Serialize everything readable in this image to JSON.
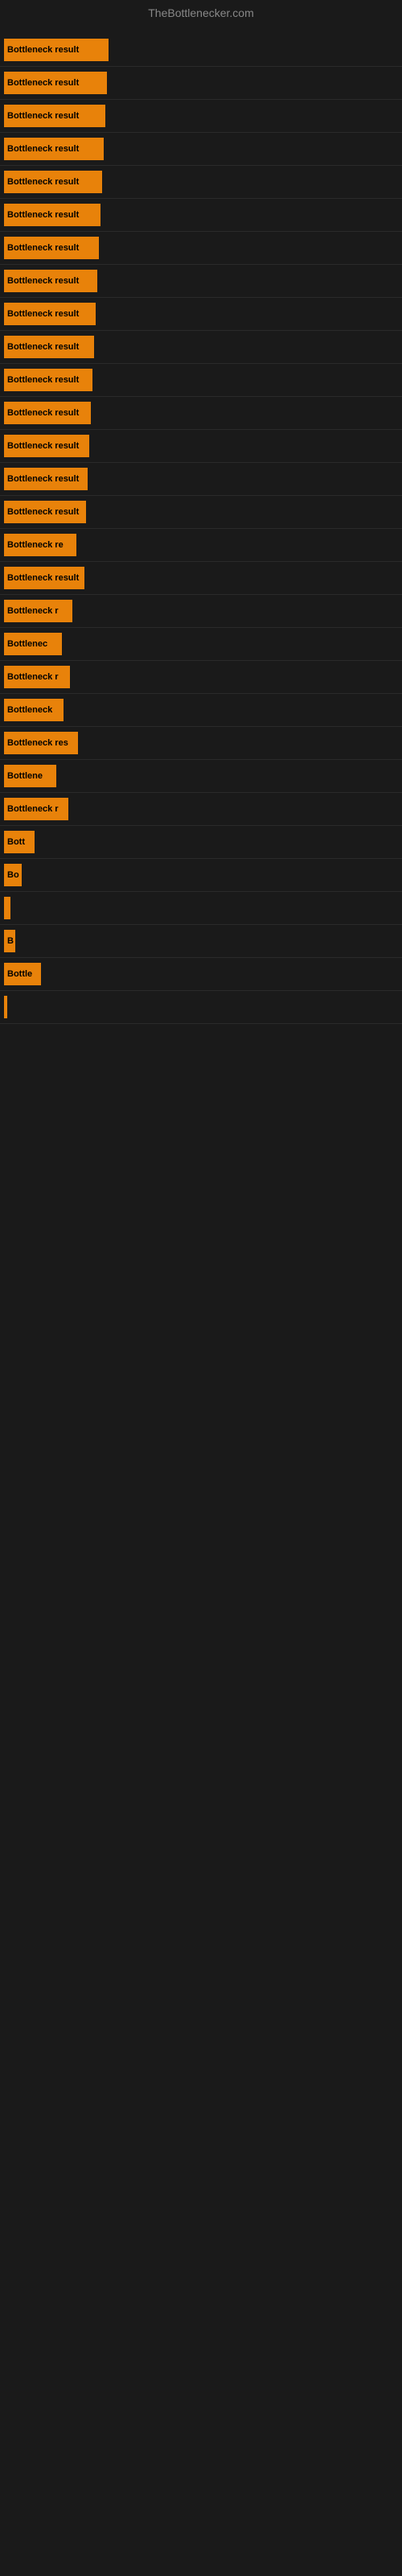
{
  "site": {
    "title": "TheBottlenecker.com"
  },
  "bars": [
    {
      "label": "Bottleneck result",
      "width": 130
    },
    {
      "label": "Bottleneck result",
      "width": 128
    },
    {
      "label": "Bottleneck result",
      "width": 126
    },
    {
      "label": "Bottleneck result",
      "width": 124
    },
    {
      "label": "Bottleneck result",
      "width": 122
    },
    {
      "label": "Bottleneck result",
      "width": 120
    },
    {
      "label": "Bottleneck result",
      "width": 118
    },
    {
      "label": "Bottleneck result",
      "width": 116
    },
    {
      "label": "Bottleneck result",
      "width": 114
    },
    {
      "label": "Bottleneck result",
      "width": 112
    },
    {
      "label": "Bottleneck result",
      "width": 110
    },
    {
      "label": "Bottleneck result",
      "width": 108
    },
    {
      "label": "Bottleneck result",
      "width": 106
    },
    {
      "label": "Bottleneck result",
      "width": 104
    },
    {
      "label": "Bottleneck result",
      "width": 102
    },
    {
      "label": "Bottleneck re",
      "width": 90
    },
    {
      "label": "Bottleneck result",
      "width": 100
    },
    {
      "label": "Bottleneck r",
      "width": 85
    },
    {
      "label": "Bottlenec",
      "width": 72
    },
    {
      "label": "Bottleneck r",
      "width": 82
    },
    {
      "label": "Bottleneck",
      "width": 74
    },
    {
      "label": "Bottleneck res",
      "width": 92
    },
    {
      "label": "Bottlene",
      "width": 65
    },
    {
      "label": "Bottleneck r",
      "width": 80
    },
    {
      "label": "Bott",
      "width": 38
    },
    {
      "label": "Bo",
      "width": 22
    },
    {
      "label": "",
      "width": 8
    },
    {
      "label": "B",
      "width": 14
    },
    {
      "label": "Bottle",
      "width": 46
    },
    {
      "label": "",
      "width": 4
    }
  ]
}
